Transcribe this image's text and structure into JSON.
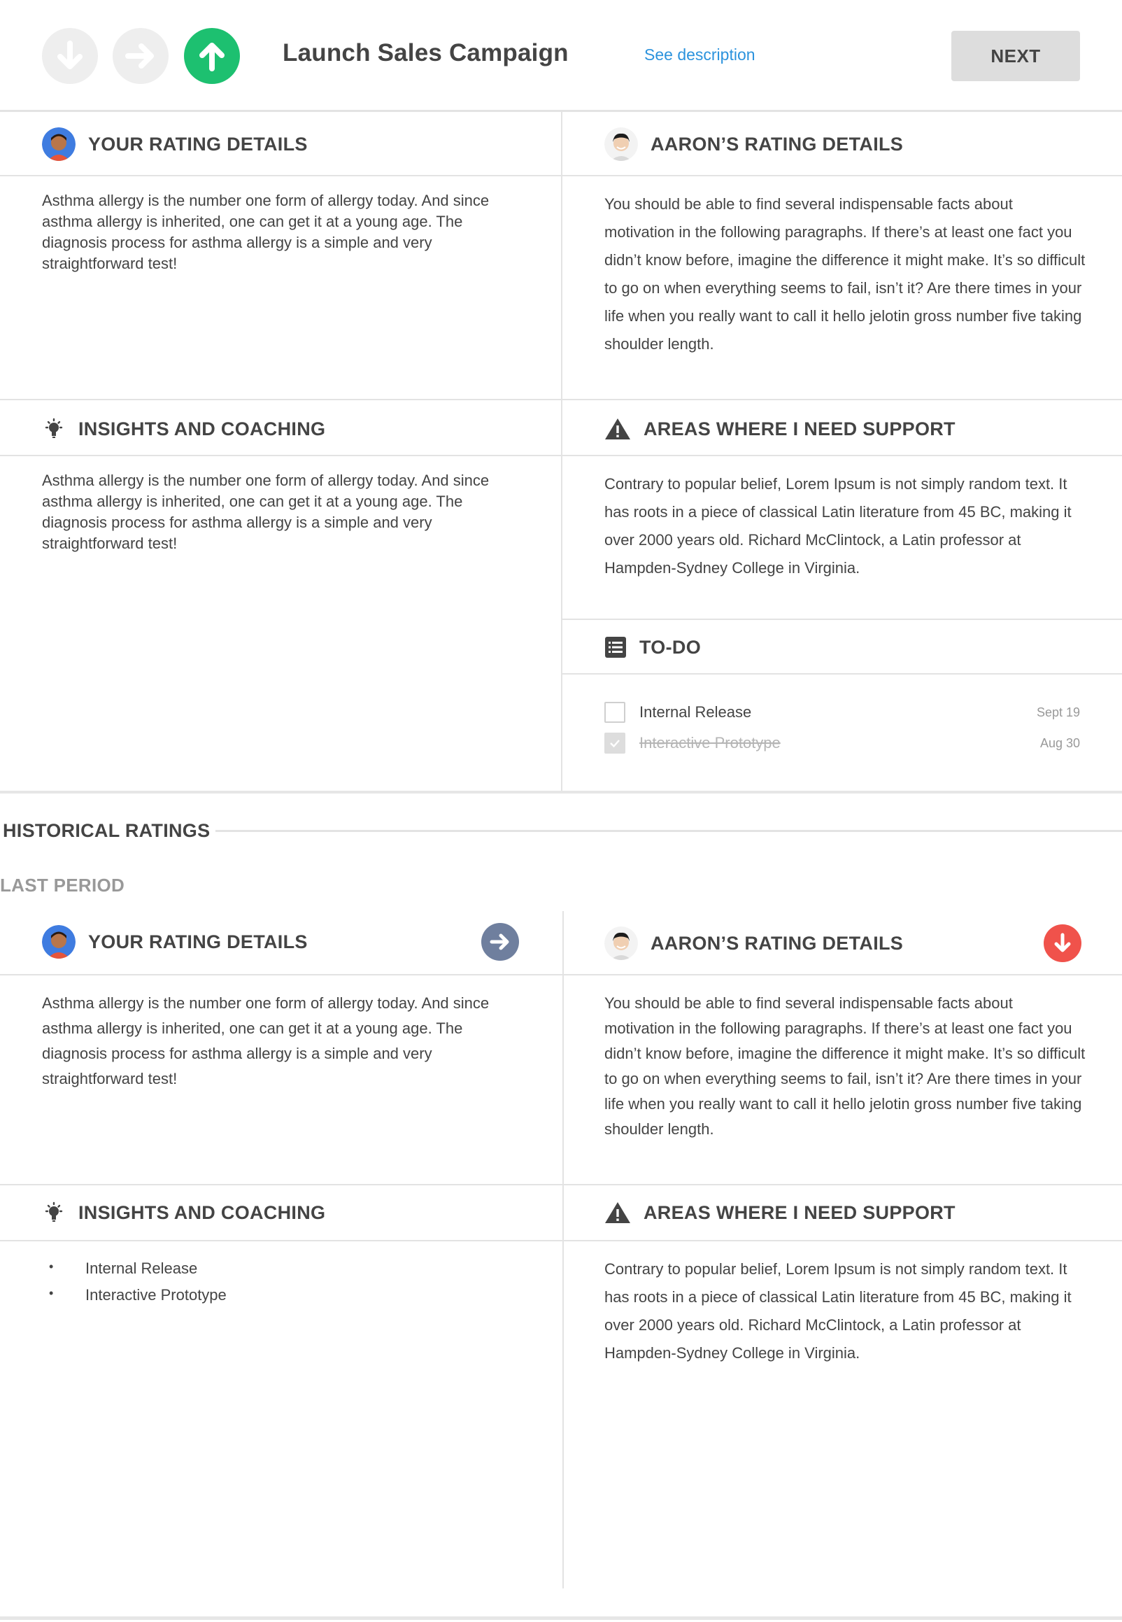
{
  "header": {
    "title": "Launch Sales Campaign",
    "see_description": "See description",
    "next_label": "NEXT",
    "rating_buttons": [
      {
        "icon": "arrow-down-icon",
        "state": "inactive"
      },
      {
        "icon": "arrow-right-icon",
        "state": "inactive"
      },
      {
        "icon": "arrow-up-icon",
        "state": "selected",
        "color": "#1dc070"
      }
    ]
  },
  "current": {
    "your_rating": {
      "title": "YOUR RATING DETAILS",
      "text": "Asthma allergy is the number one form of allergy today. And since asthma allergy is inherited, one can get it at a young age. The diagnosis process for asthma allergy is a simple and very straightforward test!"
    },
    "aaron_rating": {
      "title": "AARON’S RATING DETAILS",
      "text": "You should be able to find several indispensable facts about motivation in the following paragraphs. If there’s at least one fact you didn’t know before, imagine the difference it might make. It’s so difficult to go on when everything seems to fail, isn’t it? Are there times in your life when you really want to call it hello jelotin gross number five taking shoulder length."
    },
    "insights": {
      "title": "INSIGHTS AND COACHING",
      "text": "Asthma allergy is the number one form of allergy today. And since asthma allergy is inherited, one can get it at a young age. The diagnosis process for asthma allergy is a simple and very straightforward test!"
    },
    "support": {
      "title": "AREAS WHERE I NEED SUPPORT",
      "text": "Contrary to popular belief, Lorem Ipsum is not simply random text. It has roots in a piece of classical Latin literature from 45 BC, making it over 2000 years old. Richard McClintock, a Latin professor at Hampden-Sydney College in Virginia."
    },
    "todo": {
      "title": "TO-DO",
      "items": [
        {
          "label": "Internal Release",
          "date": "Sept 19",
          "done": false
        },
        {
          "label": "Interactive Prototype",
          "date": "Aug 30",
          "done": true
        }
      ]
    }
  },
  "historical": {
    "title": "HISTORICAL RATINGS",
    "period_label": "LAST PERIOD",
    "your_rating": {
      "title": "YOUR RATING DETAILS",
      "rating_icon": "arrow-right-icon",
      "rating_color": "#6f7f9e",
      "text": "Asthma allergy is the number one form of allergy today. And since asthma allergy is inherited, one can get it at a young age. The diagnosis process for asthma allergy is a simple and very straightforward test!"
    },
    "aaron_rating": {
      "title": "AARON’S RATING DETAILS",
      "rating_icon": "arrow-down-icon",
      "rating_color": "#f0524b",
      "text": "You should be able to find several indispensable facts about motivation in the following paragraphs. If there’s at least one fact you didn’t know before, imagine the difference it might make. It’s so difficult to go on when everything seems to fail, isn’t it? Are there times in your life when you really want to call it hello jelotin gross number five taking shoulder length."
    },
    "insights": {
      "title": "INSIGHTS AND COACHING",
      "items": [
        "Internal Release",
        "Interactive Prototype"
      ]
    },
    "support": {
      "title": "AREAS WHERE I NEED SUPPORT",
      "text": "Contrary to popular belief, Lorem Ipsum is not simply random text. It has roots in a piece of classical Latin literature from 45 BC, making it over 2000 years old. Richard McClintock, a Latin professor at Hampden-Sydney College in Virginia."
    }
  }
}
